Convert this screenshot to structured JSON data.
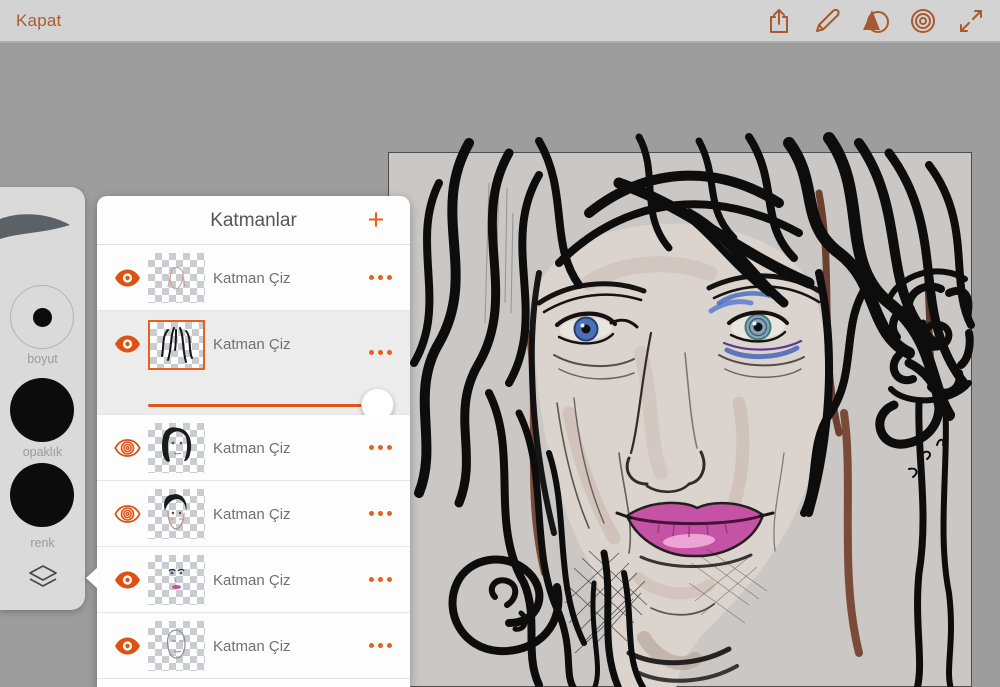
{
  "toolbar": {
    "close_label": "Kapat",
    "icons": [
      "share-icon",
      "pencil-icon",
      "shape-transform-icon",
      "brush-rings-icon",
      "fullscreen-icon"
    ]
  },
  "tools": {
    "size_label": "boyut",
    "opacity_label": "opaklık",
    "color_label": "renk",
    "layers_icon": "layers-icon"
  },
  "layers_panel": {
    "title": "Katmanlar",
    "add_label": "+",
    "selected_index": 1,
    "selected_opacity_percent": 95,
    "rows": [
      {
        "label": "Katman Çiz",
        "eye": "filled",
        "selected": false
      },
      {
        "label": "Katman Çiz",
        "eye": "filled",
        "selected": true
      },
      {
        "label": "Katman Çiz",
        "eye": "outline",
        "selected": false
      },
      {
        "label": "Katman Çiz",
        "eye": "outline",
        "selected": false
      },
      {
        "label": "Katman Çiz",
        "eye": "filled",
        "selected": false
      },
      {
        "label": "Katman Çiz",
        "eye": "filled",
        "selected": false
      }
    ]
  },
  "colors": {
    "accent_orange": "#e8601c",
    "eye_orange": "#dd5113",
    "toolbar_icon": "#a9592f",
    "toolbar_bg": "#d3d3d3",
    "workspace_bg": "#9d9d9d",
    "canvas_bg": "#cac7c4",
    "panel_bg": "#fdfdfd",
    "selected_row_bg": "#ececec"
  }
}
